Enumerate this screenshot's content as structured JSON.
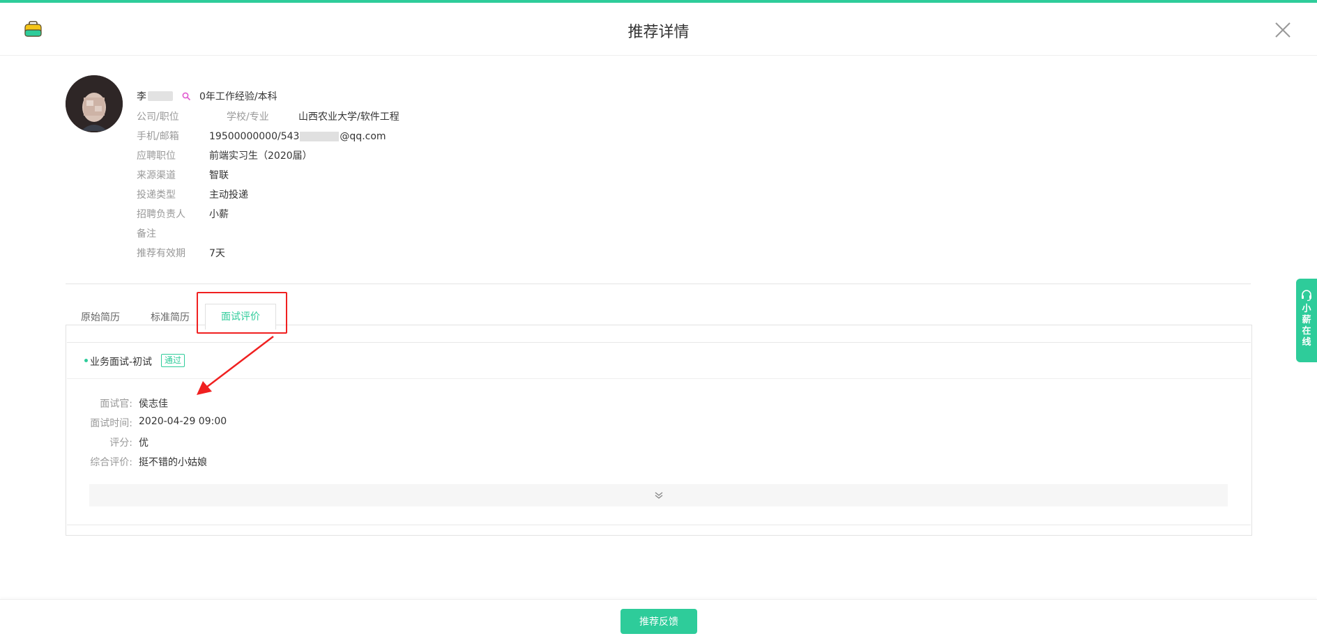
{
  "header": {
    "title": "推荐详情"
  },
  "candidate": {
    "name": "李",
    "experience": "0年工作经验/本科",
    "rows": [
      {
        "label": "公司/职位",
        "value": ""
      },
      {
        "label": "手机/邮箱",
        "value_prefix": "19500000000/543",
        "value_suffix": "@qq.com"
      },
      {
        "label": "应聘职位",
        "value": "前端实习生（2020届）"
      },
      {
        "label": "来源渠道",
        "value": "智联"
      },
      {
        "label": "投递类型",
        "value": "主动投递"
      },
      {
        "label": "招聘负责人",
        "value": "小薪"
      },
      {
        "label": "备注",
        "value": ""
      },
      {
        "label": "推荐有效期",
        "value": "7天"
      }
    ],
    "school_label": "学校/专业",
    "school_value": "山西农业大学/软件工程"
  },
  "tabs": [
    {
      "label": "原始简历",
      "active": false
    },
    {
      "label": "标准简历",
      "active": false
    },
    {
      "label": "面试评价",
      "active": true
    }
  ],
  "evaluation": {
    "title": "业务面试-初试",
    "status": "通过",
    "items": [
      {
        "label": "面试官:",
        "value": "侯志佳"
      },
      {
        "label": "面试时间:",
        "value": "2020-04-29 09:00"
      },
      {
        "label": "评分:",
        "value": "优"
      },
      {
        "label": "综合评价:",
        "value": "挺不错的小姑娘"
      }
    ]
  },
  "side_service": {
    "label": "小薪在线"
  },
  "footer": {
    "button": "推荐反馈"
  },
  "colors": {
    "accent": "#2ecc9a",
    "annotation": "#f02020"
  },
  "icons": [
    "logo-icon",
    "close-icon",
    "female-icon",
    "chevron-double-down-icon",
    "headset-icon"
  ]
}
